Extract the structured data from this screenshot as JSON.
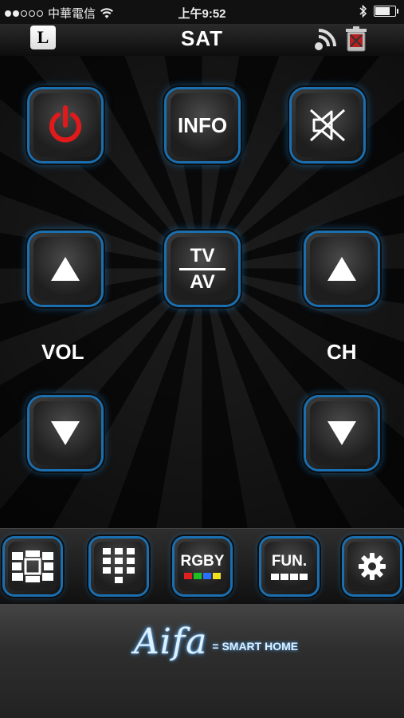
{
  "status_bar": {
    "carrier": "中華電信",
    "time": "上午9:52",
    "wifi_icon": "wifi-icon",
    "bluetooth_icon": "bluetooth-icon",
    "battery_icon": "battery-icon"
  },
  "header": {
    "lang_button_label": "L",
    "title": "SAT",
    "signal_icon": "wireless-signal-icon",
    "trash_icon": "trash-icon"
  },
  "remote": {
    "power_icon": "power-icon",
    "info_label": "INFO",
    "mute_icon": "mute-speaker-icon",
    "vol_label": "VOL",
    "ch_label": "CH",
    "tv_label": "TV",
    "av_label": "AV",
    "up_icon": "triangle-up-icon",
    "down_icon": "triangle-down-icon",
    "accent_color": "#1a8fe0",
    "power_color": "#e01a1a"
  },
  "bottom_bar": {
    "nav_pad_icon": "navigation-pad-icon",
    "number_pad_icon": "number-keypad-icon",
    "rgby_label": "RGBY",
    "rgby_colors": [
      "#e02020",
      "#20c020",
      "#2a70ff",
      "#f0e020"
    ],
    "fun_label": "FUN.",
    "settings_icon": "gear-icon"
  },
  "footer": {
    "brand_script": "Aifa",
    "brand_tagline": "= SMART HOME"
  }
}
